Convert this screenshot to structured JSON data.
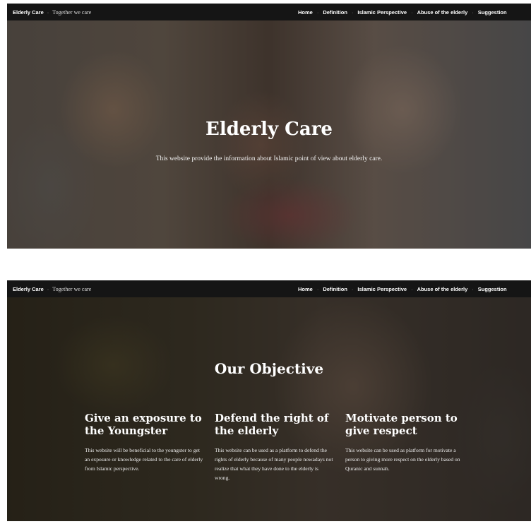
{
  "brand": {
    "name": "Elderly Care",
    "separator": "·",
    "tagline": "Together we care"
  },
  "nav": {
    "items": [
      "Home",
      "Definition",
      "Islamic Perspective",
      "Abuse of the elderly",
      "Suggestion"
    ],
    "separator": "·"
  },
  "hero": {
    "title": "Elderly Care",
    "subtitle": "This website provide the information about Islamic point of view about elderly care."
  },
  "objective": {
    "title": "Our Objective",
    "columns": [
      {
        "heading": "Give an exposure to the Youngster",
        "text": "This website will be beneficial to the youngster to get an exposure or knowledge related to the care of elderly from Islamic perspective."
      },
      {
        "heading": "Defend the right of the elderly",
        "text": "This website can be used as a platform to defend the rights of elderly because of many people nowadays not realize that what they have done to the elderly is wrong."
      },
      {
        "heading": "Motivate person to give respect",
        "text": "This website can be used as platform for motivate a person to giving more respect on the elderly based on Quranic and sunnah."
      }
    ]
  },
  "colors": {
    "navbar": "#151515",
    "text": "#ffffff"
  }
}
